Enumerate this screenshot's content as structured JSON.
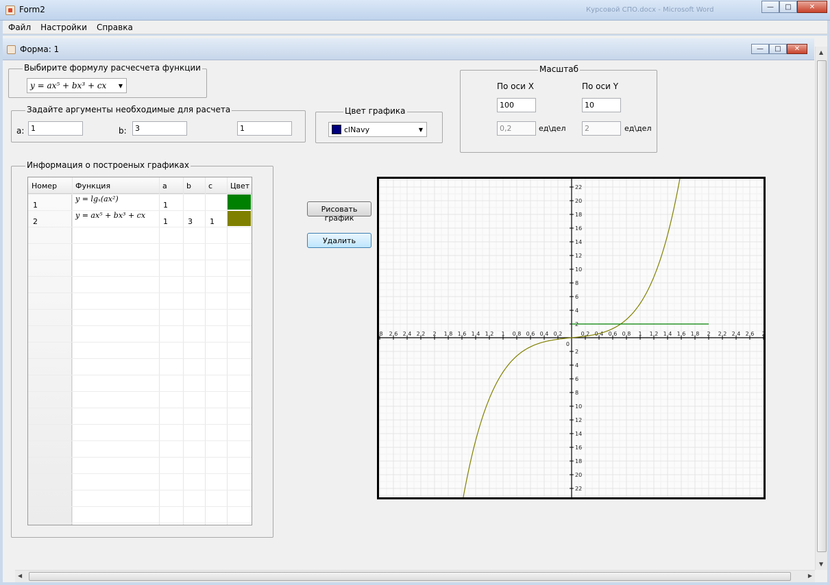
{
  "window": {
    "title": "Form2",
    "ghost_text": "Курсовой СПО.docx - Microsoft Word"
  },
  "menu": [
    "Файл",
    "Настройки",
    "Справка"
  ],
  "child_window": {
    "title": "Форма: 1"
  },
  "formula_group": {
    "title": "Выбирите формулу расчесчета функции",
    "selected": "y = ax⁵ + bx³ + cx"
  },
  "args_group": {
    "title": "Задайте аргументы необходимые для расчета",
    "a_label": "a:",
    "a_value": "1",
    "b_label": "b:",
    "b_value": "3",
    "c_value": "1"
  },
  "color_group": {
    "title": "Цвет графика",
    "selected": "clNavy",
    "swatch_color": "#000080"
  },
  "scale_group": {
    "title": "Масштаб",
    "x_label": "По оси X",
    "y_label": "По оси Y",
    "x_value": "100",
    "y_value": "10",
    "x_div": "0,2",
    "y_div": "2",
    "unit_x": "ед\\дел",
    "unit_y": "ед\\дел"
  },
  "info_group": {
    "title": "Информация о построеных графиках",
    "columns": [
      "Номер",
      "Функция",
      "a",
      "b",
      "c",
      "Цвет"
    ],
    "rows": [
      {
        "num": "1",
        "func": "y = lgₓ(ax²)",
        "a": "1",
        "b": "",
        "c": "",
        "color": "#008000"
      },
      {
        "num": "2",
        "func": "y = ax⁵ + bx³ + cx",
        "a": "1",
        "b": "3",
        "c": "1",
        "color": "#808000"
      }
    ]
  },
  "buttons": {
    "draw": "Рисовать график",
    "delete": "Удалить"
  },
  "graph": {
    "x_ticks_left": [
      "8",
      "2,6",
      "2,4",
      "2,2",
      "2",
      "1,8",
      "1,6",
      "1,4",
      "1,2",
      "1",
      "0,8",
      "0,6",
      "0,4",
      "0,2"
    ],
    "x_ticks_right": [
      "0,2",
      "0,4",
      "0,6",
      "0,8",
      "1",
      "1,2",
      "1,4",
      "1,6",
      "1,8",
      "2",
      "2,2",
      "2,4",
      "2,6",
      "2"
    ],
    "y_ticks_up": [
      "22",
      "20",
      "18",
      "16",
      "14",
      "12",
      "10",
      "8",
      "6",
      "4",
      "2"
    ],
    "y_ticks_down": [
      "2",
      "4",
      "6",
      "8",
      "10",
      "12",
      "14",
      "16",
      "18",
      "20",
      "22"
    ],
    "origin": "0",
    "series": [
      {
        "color": "#808000",
        "fn": "ax5+bx3+cx",
        "a": 1,
        "b": 3,
        "c": 1
      },
      {
        "color": "#008000",
        "fn": "horizontal",
        "y": 2,
        "x_from": 0,
        "x_to": 2
      }
    ]
  }
}
